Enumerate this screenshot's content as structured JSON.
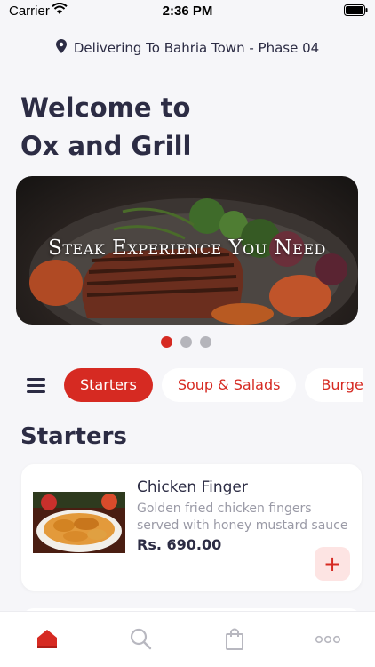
{
  "status_bar": {
    "carrier": "Carrier",
    "time": "2:36 PM"
  },
  "delivery": {
    "text": "Delivering To Bahria Town - Phase 04",
    "icon": "location-pin-icon"
  },
  "welcome": {
    "line1": "Welcome to",
    "line2": "Ox and Grill"
  },
  "banner": {
    "caption": "Steak Experience You Need",
    "slide_count": 3,
    "active_slide": 1
  },
  "categories": [
    {
      "label": "Starters",
      "active": true
    },
    {
      "label": "Soup & Salads",
      "active": false
    },
    {
      "label": "Burgers",
      "active": false
    }
  ],
  "section": {
    "title": "Starters"
  },
  "items": [
    {
      "name": "Chicken Finger",
      "description": "Golden fried chicken fingers served with honey mustard sauce",
      "price": "Rs. 690.00",
      "add_icon": "plus-icon"
    }
  ],
  "tabs": [
    {
      "icon": "home-icon",
      "active": true
    },
    {
      "icon": "search-icon",
      "active": false
    },
    {
      "icon": "shopping-bag-icon",
      "active": false
    },
    {
      "icon": "more-icon",
      "active": false
    }
  ],
  "colors": {
    "accent": "#d62a22",
    "text": "#2c2c44",
    "muted": "#9a9aa6",
    "background": "#f6f6f9"
  }
}
